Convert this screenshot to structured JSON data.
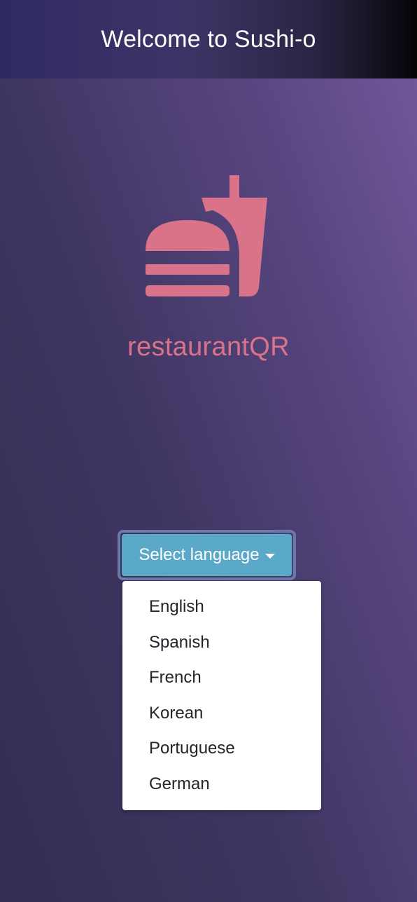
{
  "header": {
    "title": "Welcome to Sushi-o"
  },
  "brand": {
    "name": "restaurantQR",
    "logo_icon": "burger-and-drink-icon",
    "accent_color": "#d9738a"
  },
  "language_selector": {
    "button_label": "Select language",
    "button_color": "#5ba9c9",
    "options": [
      "English",
      "Spanish",
      "French",
      "Korean",
      "Portuguese",
      "German"
    ]
  }
}
